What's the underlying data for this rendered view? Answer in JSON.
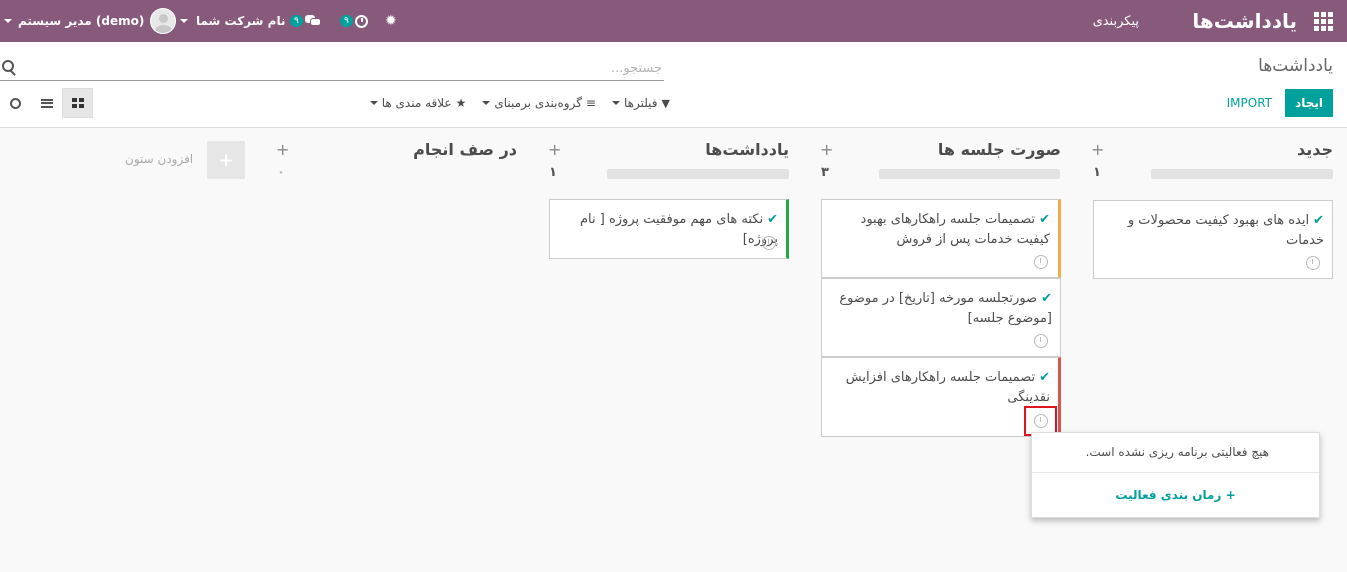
{
  "topbar": {
    "app_title": "یادداشت‌ها",
    "menu_config": "پیکربندی",
    "user_name": "مدیر سیستم (demo)",
    "company": "نام شرکت شما",
    "messages_count": "۹",
    "activities_count": "۹"
  },
  "control": {
    "breadcrumb": "یادداشت‌ها",
    "search_placeholder": "جستجو...",
    "create_label": "ایجاد",
    "import_label": "IMPORT",
    "filters_label": "فیلترها",
    "groupby_label": "گروه‌بندی برمبنای",
    "favorites_label": "علاقه مندی ها"
  },
  "columns": [
    {
      "title": "جدید",
      "count": "۱"
    },
    {
      "title": "صورت جلسه ها",
      "count": "۳"
    },
    {
      "title": "یادداشت‌ها",
      "count": "۱"
    },
    {
      "title": "در صف انجام",
      "count": "۰"
    }
  ],
  "cards": [
    {
      "text": "ایده های بهبود کیفیت محصولات و خدمات"
    },
    {
      "text": "تصمیمات جلسه راهکارهای بهبود کیفیت خدمات پس از فروش"
    },
    {
      "text": "صورتجلسه مورخه [تاریخ] در موضوع [موضوع جلسه]"
    },
    {
      "text": "تصمیمات جلسه راهکارهای افزایش نقدینگی"
    },
    {
      "text": "نکته های مهم موفقیت پروژه [ نام پروژه]"
    }
  ],
  "add_column_label": "افزودن ستون",
  "popover": {
    "message": "هیچ فعالیتی برنامه ریزی نشده است.",
    "schedule_label": "زمان بندی فعالیت"
  },
  "colors": {
    "brand": "#875a7b",
    "accent": "#00a09d",
    "card_orange": "#f0ad4e",
    "card_red": "#d9534f",
    "card_green": "#28a745"
  }
}
